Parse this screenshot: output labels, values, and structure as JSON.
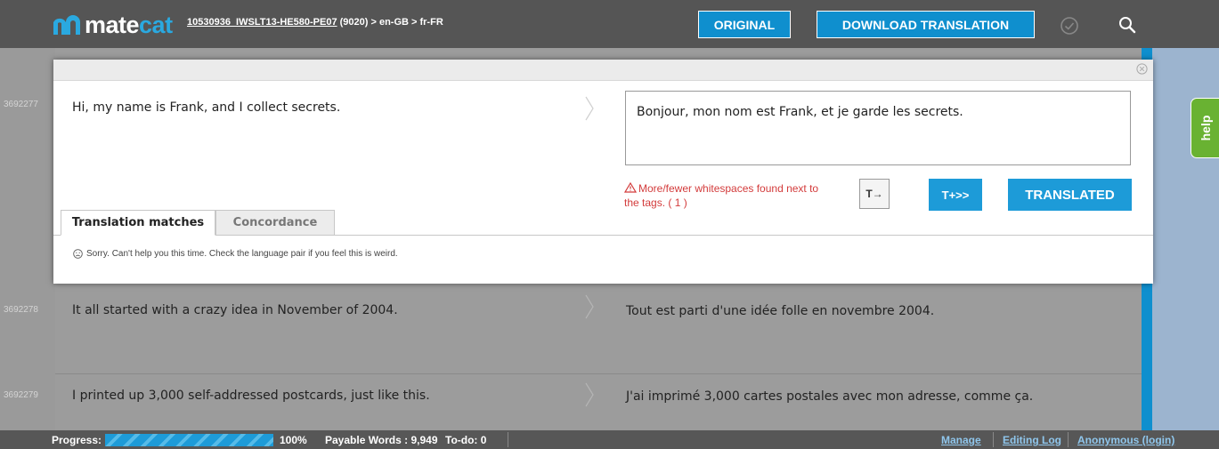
{
  "header": {
    "logo_text_a": "mate",
    "logo_text_b": "cat",
    "project_name": "10530936_IWSLT13-HE580-PE07",
    "project_rest": " (9020) > en-GB > fr-FR",
    "original_label": "ORIGINAL",
    "download_label": "DOWNLOAD TRANSLATION"
  },
  "help_label": "help",
  "active_segment": {
    "id": "3692277",
    "source": "Hi, my name is Frank, and I collect secrets.",
    "target": "Bonjour, mon nom est Frank, et je garde les secrets.",
    "warning": "More/fewer whitespaces found next to the tags. ( 1 )",
    "tag_button_label": "T→",
    "tplus_label": "T+>>",
    "translated_label": "TRANSLATED",
    "tabs": [
      {
        "label": "Translation matches"
      },
      {
        "label": "Concordance"
      }
    ],
    "matches_message": "Sorry. Can't help you this time. Check the language pair if you feel this is weird."
  },
  "segments": [
    {
      "id": "3692278",
      "source": "It all started with a crazy idea in November of 2004.",
      "target": "Tout est parti d'une idée folle en novembre 2004."
    },
    {
      "id": "3692279",
      "source": "I printed up 3,000 self-addressed postcards, just like this.",
      "target": "J'ai imprimé 3,000 cartes postales avec mon adresse, comme ça."
    }
  ],
  "footer": {
    "progress_label": "Progress:",
    "progress_value": 1.0,
    "progress_percent": "100%",
    "payable_words": "Payable Words : 9,949",
    "todo": "To-do: 0",
    "manage": "Manage",
    "editing_log": "Editing Log",
    "anonymous": "Anonymous (login)"
  },
  "colors": {
    "accent": "#0f8fce",
    "help_green": "#69b232",
    "warning_red": "#d33b3b"
  }
}
